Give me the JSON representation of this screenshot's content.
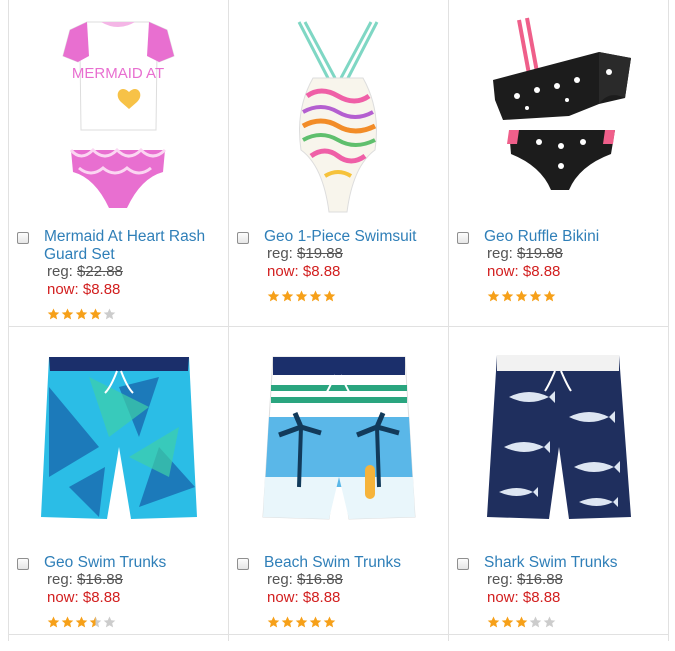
{
  "colors": {
    "link": "#2f7fb8",
    "sale": "#d21f1f",
    "star": "#f6a019",
    "star_empty": "#cccccc"
  },
  "products": [
    {
      "name": "Mermaid At Heart Rash Guard Set",
      "reg_label": "reg: ",
      "reg_price": "$22.88",
      "now": "now: $8.88",
      "rating": 4,
      "image": "rash-guard-set-image"
    },
    {
      "name": "Geo 1-Piece Swimsuit",
      "reg_label": "reg: ",
      "reg_price": "$19.88",
      "now": "now: $8.88",
      "rating": 5,
      "image": "swimsuit-image"
    },
    {
      "name": "Geo Ruffle Bikini",
      "reg_label": "reg: ",
      "reg_price": "$19.88",
      "now": "now: $8.88",
      "rating": 5,
      "image": "bikini-image"
    },
    {
      "name": "Geo Swim Trunks",
      "reg_label": "reg: ",
      "reg_price": "$16.88",
      "now": "now: $8.88",
      "rating": 3.5,
      "image": "geo-trunks-image"
    },
    {
      "name": "Beach Swim Trunks",
      "reg_label": "reg: ",
      "reg_price": "$16.88",
      "now": "now: $8.88",
      "rating": 5,
      "image": "beach-trunks-image"
    },
    {
      "name": "Shark Swim Trunks",
      "reg_label": "reg: ",
      "reg_price": "$16.88",
      "now": "now: $8.88",
      "rating": 3,
      "image": "shark-trunks-image"
    }
  ],
  "mermaid_print": "MERMAID AT"
}
